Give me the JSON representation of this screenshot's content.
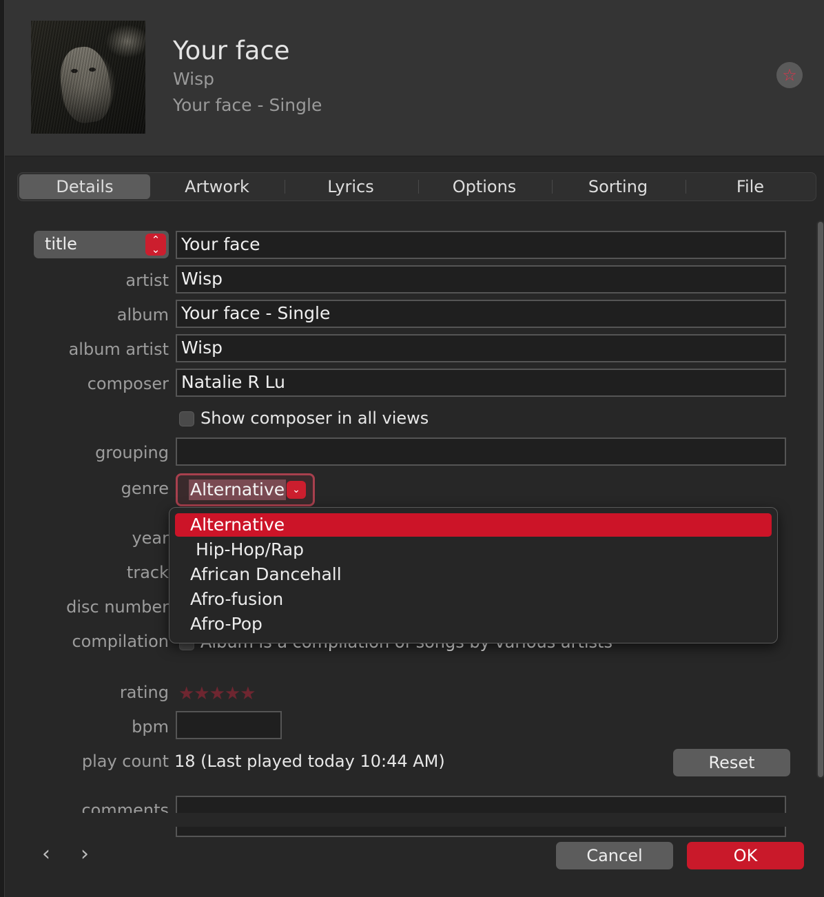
{
  "header": {
    "title": "Your face",
    "artist": "Wisp",
    "album": "Your face - Single",
    "love_icon": "star-icon"
  },
  "tabs": [
    "Details",
    "Artwork",
    "Lyrics",
    "Options",
    "Sorting",
    "File"
  ],
  "active_tab": "Details",
  "fields": {
    "title_selector": "title",
    "title": "Your face",
    "artist_label": "artist",
    "artist": "Wisp",
    "album_label": "album",
    "album": "Your face - Single",
    "album_artist_label": "album artist",
    "album_artist": "Wisp",
    "composer_label": "composer",
    "composer": "Natalie R Lu",
    "show_composer": "Show composer in all views",
    "grouping_label": "grouping",
    "grouping": "",
    "genre_label": "genre",
    "genre": "Alternative",
    "year_label": "year",
    "track_label": "track",
    "disc_label": "disc number",
    "compilation_label": "compilation",
    "compilation_text": "Album is a compilation of songs by various artists",
    "rating_label": "rating",
    "rating_stars": "★★★★★",
    "rating_value": 0,
    "bpm_label": "bpm",
    "bpm": "",
    "play_count_label": "play count",
    "play_count": "18 (Last played today 10:44 AM)",
    "comments_label": "comments"
  },
  "genre_dropdown": [
    "Alternative",
    " Hip-Hop/Rap",
    "African Dancehall",
    "Afro-fusion",
    "Afro-Pop"
  ],
  "buttons": {
    "reset": "Reset",
    "cancel": "Cancel",
    "ok": "OK",
    "prev": "‹",
    "next": "›"
  },
  "colors": {
    "accent": "#cc1428",
    "background": "#272727",
    "header": "#343434"
  }
}
